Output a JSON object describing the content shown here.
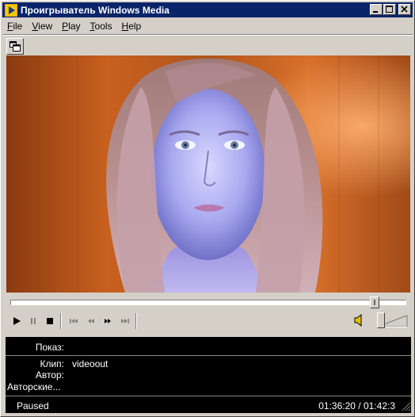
{
  "window": {
    "title": "Проигрыватель Windows Media"
  },
  "menu": {
    "items": [
      {
        "label": "File",
        "ul": "F",
        "rest": "ile"
      },
      {
        "label": "View",
        "ul": "V",
        "rest": "iew"
      },
      {
        "label": "Play",
        "ul": "P",
        "rest": "lay"
      },
      {
        "label": "Tools",
        "ul": "T",
        "rest": "ools"
      },
      {
        "label": "Help",
        "ul": "H",
        "rest": "elp"
      }
    ]
  },
  "playback": {
    "position_fraction": 0.93,
    "volume_fraction": 0.1
  },
  "icons": {
    "app": "media-player-icon",
    "minimize": "minimize-icon",
    "maximize": "maximize-icon",
    "close": "close-icon",
    "view_toggle": "compact-view-icon",
    "play": "play-icon",
    "pause": "pause-icon",
    "stop": "stop-icon",
    "prev": "skip-back-icon",
    "rewind": "rewind-icon",
    "ffwd": "fast-forward-icon",
    "next": "skip-forward-icon",
    "volume": "speaker-icon"
  },
  "info": {
    "show_label": "Показ:",
    "show_value": "",
    "clip_label": "Клип:",
    "clip_value": "videoout",
    "author_label": "Автор:",
    "author_value": "",
    "copyright_label": "Авторские...",
    "copyright_value": "",
    "status": "Paused",
    "time": "01:36:20 / 01:42:3"
  },
  "colors": {
    "titlebar": "#0a246a",
    "face": "#d4d0c8",
    "info_bg": "#000000"
  }
}
